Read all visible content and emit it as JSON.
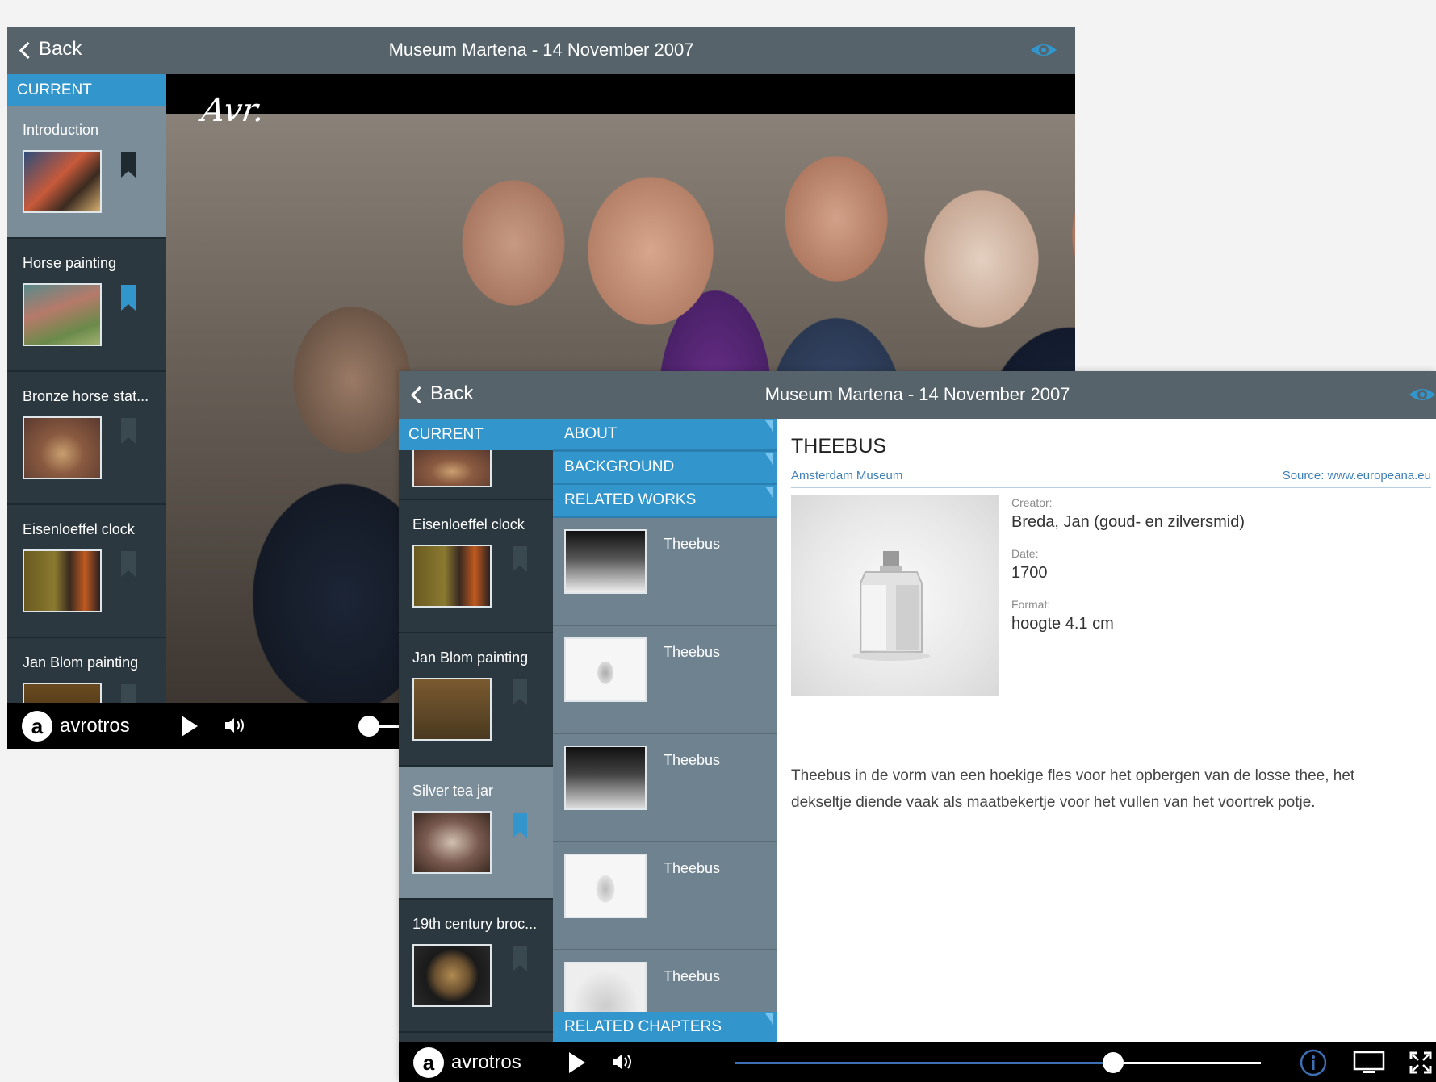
{
  "window_back": {
    "back_label": "Back",
    "title": "Museum Martena - 14 November 2007",
    "current_label": "CURRENT",
    "chapters": [
      {
        "label": "Introduction"
      },
      {
        "label": "Horse painting"
      },
      {
        "label": "Bronze horse stat..."
      },
      {
        "label": "Eisenloeffel clock"
      },
      {
        "label": "Jan Blom painting"
      }
    ],
    "brand": "avrotros",
    "video_logo": "Avr."
  },
  "window_front": {
    "back_label": "Back",
    "title": "Museum Martena - 14 November 2007",
    "current_label": "CURRENT",
    "chapters": [
      {
        "label": "Eisenloeffel clock"
      },
      {
        "label": "Jan Blom painting"
      },
      {
        "label": "Silver tea jar"
      },
      {
        "label": "19th century broc..."
      }
    ],
    "menu": {
      "about": "ABOUT",
      "background": "BACKGROUND",
      "related_works": "RELATED WORKS",
      "related_chapters": "RELATED CHAPTERS"
    },
    "related_works": [
      {
        "label": "Theebus"
      },
      {
        "label": "Theebus"
      },
      {
        "label": "Theebus"
      },
      {
        "label": "Theebus"
      },
      {
        "label": "Theebus"
      }
    ],
    "detail": {
      "title": "THEEBUS",
      "museum": "Amsterdam Museum",
      "source": "Source: www.europeana.eu",
      "creator_label": "Creator:",
      "creator": "Breda, Jan (goud- en zilversmid)",
      "date_label": "Date:",
      "date": "1700",
      "format_label": "Format:",
      "format": "hoogte 4.1 cm",
      "description": "Theebus in de vorm van een hoekige fles voor het opbergen van de losse thee, het dekseltje diende vaak als maatbekertje voor het vullen van het voortrek potje."
    },
    "brand": "avrotros",
    "progress_fraction": 0.72
  },
  "colors": {
    "accent": "#3296cd",
    "titlebar": "#56636a",
    "sidebar": "#2b3840"
  }
}
